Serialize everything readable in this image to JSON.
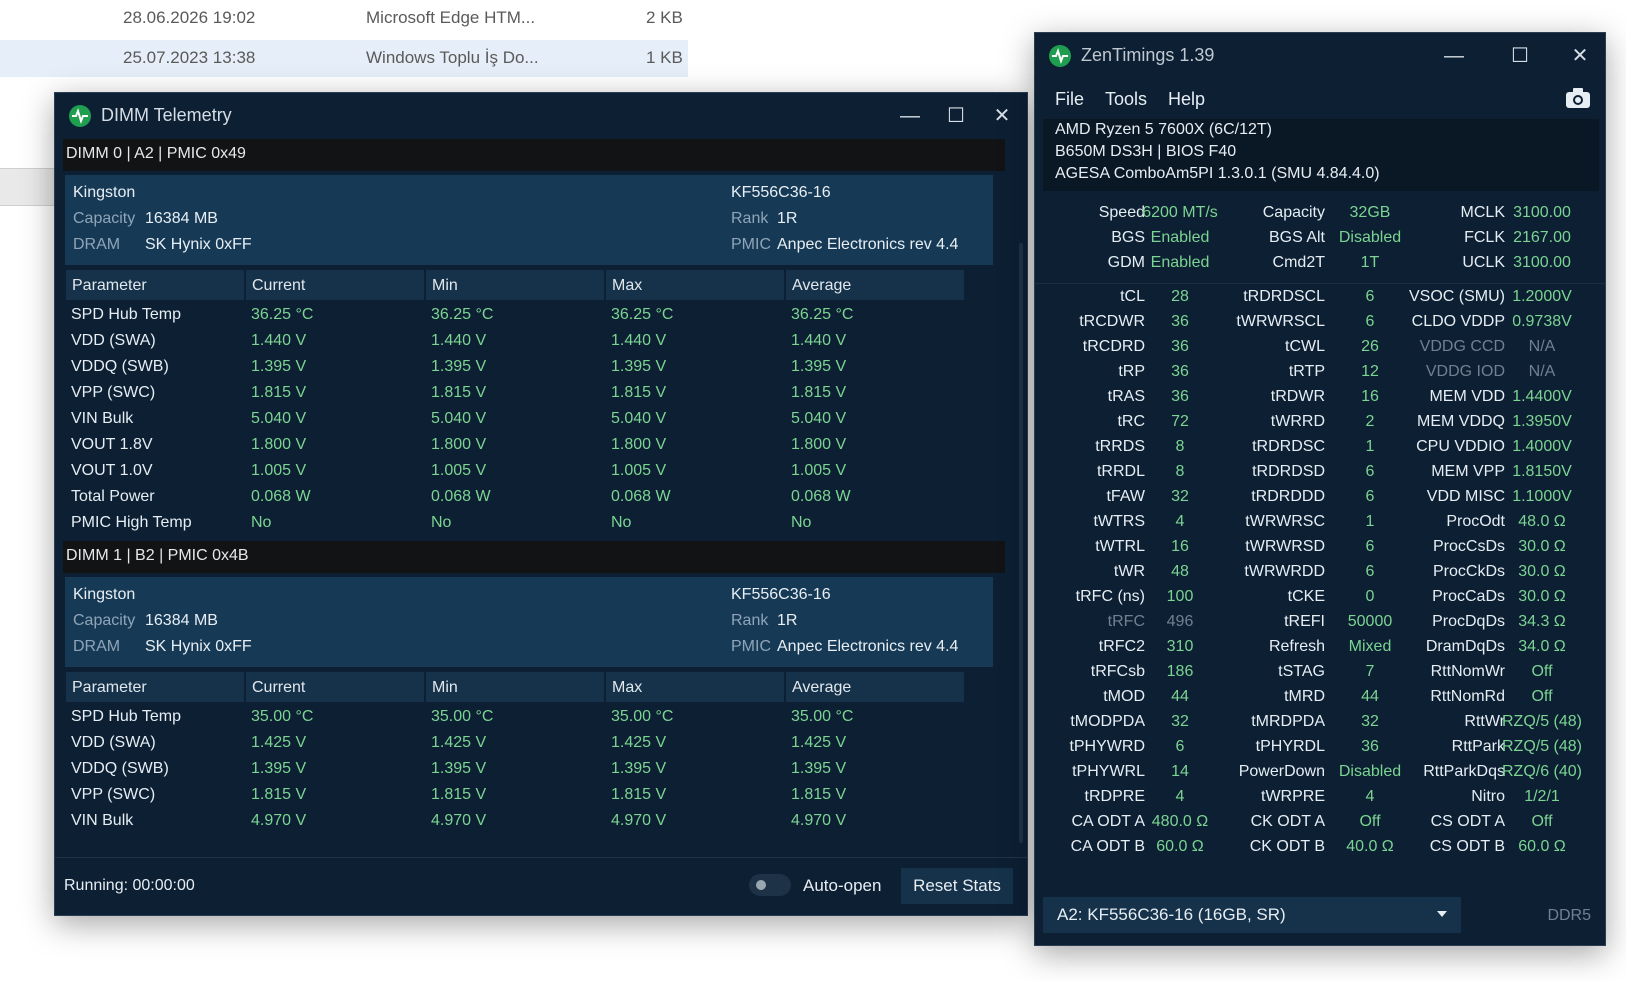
{
  "explorer": {
    "rows": [
      {
        "date": "28.06.2026 19:02",
        "type": "Microsoft Edge HTM...",
        "size": "2 KB"
      },
      {
        "date": "25.07.2023 13:38",
        "type": "Windows Toplu İş Do...",
        "size": "1 KB"
      }
    ]
  },
  "dimm_window": {
    "title": "DIMM Telemetry",
    "header_labels": {
      "parameter": "Parameter",
      "current": "Current",
      "min": "Min",
      "max": "Max",
      "average": "Average"
    },
    "info_labels": {
      "capacity": "Capacity",
      "dram": "DRAM",
      "rank": "Rank",
      "pmic": "PMIC"
    },
    "modules": [
      {
        "header": "DIMM 0 | A2 | PMIC 0x49",
        "vendor": "Kingston",
        "capacity": "16384 MB",
        "dram": "SK Hynix 0xFF",
        "part": "KF556C36-16",
        "rank": "1R",
        "pmic": "Anpec Electronics rev 4.4",
        "rows": [
          {
            "name": "SPD Hub Temp",
            "current": "36.25 °C",
            "min": "36.25 °C",
            "max": "36.25 °C",
            "avg": "36.25 °C"
          },
          {
            "name": "VDD (SWA)",
            "current": "1.440 V",
            "min": "1.440 V",
            "max": "1.440 V",
            "avg": "1.440 V"
          },
          {
            "name": "VDDQ (SWB)",
            "current": "1.395 V",
            "min": "1.395 V",
            "max": "1.395 V",
            "avg": "1.395 V"
          },
          {
            "name": "VPP (SWC)",
            "current": "1.815 V",
            "min": "1.815 V",
            "max": "1.815 V",
            "avg": "1.815 V"
          },
          {
            "name": "VIN Bulk",
            "current": "5.040 V",
            "min": "5.040 V",
            "max": "5.040 V",
            "avg": "5.040 V"
          },
          {
            "name": "VOUT 1.8V",
            "current": "1.800 V",
            "min": "1.800 V",
            "max": "1.800 V",
            "avg": "1.800 V"
          },
          {
            "name": "VOUT 1.0V",
            "current": "1.005 V",
            "min": "1.005 V",
            "max": "1.005 V",
            "avg": "1.005 V"
          },
          {
            "name": "Total Power",
            "current": "0.068 W",
            "min": "0.068 W",
            "max": "0.068 W",
            "avg": "0.068 W"
          },
          {
            "name": "PMIC High Temp",
            "current": "No",
            "min": "No",
            "max": "No",
            "avg": "No"
          }
        ]
      },
      {
        "header": "DIMM 1 | B2 | PMIC 0x4B",
        "vendor": "Kingston",
        "capacity": "16384 MB",
        "dram": "SK Hynix 0xFF",
        "part": "KF556C36-16",
        "rank": "1R",
        "pmic": "Anpec Electronics rev 4.4",
        "rows": [
          {
            "name": "SPD Hub Temp",
            "current": "35.00 °C",
            "min": "35.00 °C",
            "max": "35.00 °C",
            "avg": "35.00 °C"
          },
          {
            "name": "VDD (SWA)",
            "current": "1.425 V",
            "min": "1.425 V",
            "max": "1.425 V",
            "avg": "1.425 V"
          },
          {
            "name": "VDDQ (SWB)",
            "current": "1.395 V",
            "min": "1.395 V",
            "max": "1.395 V",
            "avg": "1.395 V"
          },
          {
            "name": "VPP (SWC)",
            "current": "1.815 V",
            "min": "1.815 V",
            "max": "1.815 V",
            "avg": "1.815 V"
          },
          {
            "name": "VIN Bulk",
            "current": "4.970 V",
            "min": "4.970 V",
            "max": "4.970 V",
            "avg": "4.970 V"
          }
        ]
      }
    ],
    "running": "Running: 00:00:00",
    "auto_open": "Auto-open",
    "reset": "Reset Stats"
  },
  "zen_window": {
    "title": "ZenTimings 1.39",
    "menu": [
      "File",
      "Tools",
      "Help"
    ],
    "cpu": "AMD Ryzen 5 7600X (6C/12T)",
    "board": "B650M DS3H | BIOS F40",
    "agesa": "AGESA ComboAm5PI 1.3.0.1 (SMU 4.84.4.0)",
    "top_rows": [
      [
        [
          "Speed",
          "6200 MT/s"
        ],
        [
          "Capacity",
          "32GB"
        ],
        [
          "MCLK",
          "3100.00"
        ]
      ],
      [
        [
          "BGS",
          "Enabled"
        ],
        [
          "BGS Alt",
          "Disabled"
        ],
        [
          "FCLK",
          "2167.00"
        ]
      ],
      [
        [
          "GDM",
          "Enabled"
        ],
        [
          "Cmd2T",
          "1T"
        ],
        [
          "UCLK",
          "3100.00"
        ]
      ]
    ],
    "timing_rows": [
      [
        [
          "tCL",
          "28"
        ],
        [
          "tRDRDSCL",
          "6"
        ],
        [
          "VSOC (SMU)",
          "1.2000V"
        ]
      ],
      [
        [
          "tRCDWR",
          "36"
        ],
        [
          "tWRWRSCL",
          "6"
        ],
        [
          "CLDO VDDP",
          "0.9738V"
        ]
      ],
      [
        [
          "tRCDRD",
          "36"
        ],
        [
          "tCWL",
          "26"
        ],
        [
          "VDDG CCD",
          "N/A"
        ]
      ],
      [
        [
          "tRP",
          "36"
        ],
        [
          "tRTP",
          "12"
        ],
        [
          "VDDG IOD",
          "N/A"
        ]
      ],
      [
        [
          "tRAS",
          "36"
        ],
        [
          "tRDWR",
          "16"
        ],
        [
          "MEM VDD",
          "1.4400V"
        ]
      ],
      [
        [
          "tRC",
          "72"
        ],
        [
          "tWRRD",
          "2"
        ],
        [
          "MEM VDDQ",
          "1.3950V"
        ]
      ],
      [
        [
          "tRRDS",
          "8"
        ],
        [
          "tRDRDSC",
          "1"
        ],
        [
          "CPU VDDIO",
          "1.4000V"
        ]
      ],
      [
        [
          "tRRDL",
          "8"
        ],
        [
          "tRDRDSD",
          "6"
        ],
        [
          "MEM VPP",
          "1.8150V"
        ]
      ],
      [
        [
          "tFAW",
          "32"
        ],
        [
          "tRDRDDD",
          "6"
        ],
        [
          "VDD MISC",
          "1.1000V"
        ]
      ],
      [
        [
          "tWTRS",
          "4"
        ],
        [
          "tWRWRSC",
          "1"
        ],
        [
          "ProcOdt",
          "48.0 Ω"
        ]
      ],
      [
        [
          "tWTRL",
          "16"
        ],
        [
          "tWRWRSD",
          "6"
        ],
        [
          "ProcCsDs",
          "30.0 Ω"
        ]
      ],
      [
        [
          "tWR",
          "48"
        ],
        [
          "tWRWRDD",
          "6"
        ],
        [
          "ProcCkDs",
          "30.0 Ω"
        ]
      ],
      [
        [
          "tRFC (ns)",
          "100"
        ],
        [
          "tCKE",
          "0"
        ],
        [
          "ProcCaDs",
          "30.0 Ω"
        ]
      ],
      [
        [
          "tRFC",
          "496"
        ],
        [
          "tREFI",
          "50000"
        ],
        [
          "ProcDqDs",
          "34.3 Ω"
        ]
      ],
      [
        [
          "tRFC2",
          "310"
        ],
        [
          "Refresh",
          "Mixed"
        ],
        [
          "DramDqDs",
          "34.0 Ω"
        ]
      ],
      [
        [
          "tRFCsb",
          "186"
        ],
        [
          "tSTAG",
          "7"
        ],
        [
          "RttNomWr",
          "Off"
        ]
      ],
      [
        [
          "tMOD",
          "44"
        ],
        [
          "tMRD",
          "44"
        ],
        [
          "RttNomRd",
          "Off"
        ]
      ],
      [
        [
          "tMODPDA",
          "32"
        ],
        [
          "tMRDPDA",
          "32"
        ],
        [
          "RttWr",
          "RZQ/5 (48)"
        ]
      ],
      [
        [
          "tPHYWRD",
          "6"
        ],
        [
          "tPHYRDL",
          "36"
        ],
        [
          "RttPark",
          "RZQ/5 (48)"
        ]
      ],
      [
        [
          "tPHYWRL",
          "14"
        ],
        [
          "PowerDown",
          "Disabled"
        ],
        [
          "RttParkDqs",
          "RZQ/6 (40)"
        ]
      ],
      [
        [
          "tRDPRE",
          "4"
        ],
        [
          "tWRPRE",
          "4"
        ],
        [
          "Nitro",
          "1/2/1"
        ]
      ],
      [
        [
          "CA ODT A",
          "480.0 Ω"
        ],
        [
          "CK ODT A",
          "Off"
        ],
        [
          "CS ODT A",
          "Off"
        ]
      ],
      [
        [
          "CA ODT B",
          "60.0 Ω"
        ],
        [
          "CK ODT B",
          "40.0 Ω"
        ],
        [
          "CS ODT B",
          "60.0 Ω"
        ]
      ]
    ],
    "dimmed_labels": [
      "VDDG CCD",
      "VDDG IOD",
      "tRFC"
    ],
    "selected_dimm": "A2: KF556C36-16 (16GB, SR)",
    "ddr": "DDR5"
  },
  "colors": {
    "window_bg": "#0c1f33",
    "value_green": "#7cd492",
    "header_bg": "#15324a",
    "icon_green": "#1f9e4f"
  }
}
